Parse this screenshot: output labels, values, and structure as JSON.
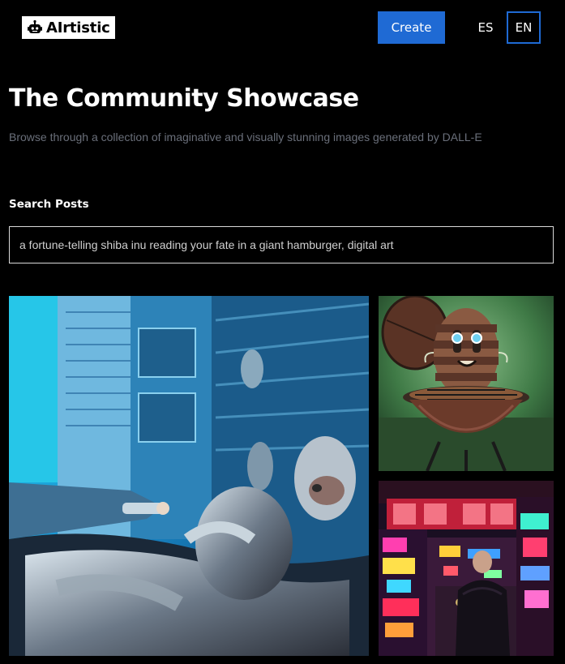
{
  "header": {
    "logo_text": "AIrtistic",
    "create_label": "Create",
    "languages": [
      "ES",
      "EN"
    ],
    "active_language": "EN"
  },
  "intro": {
    "title": "The Community Showcase",
    "subtitle": "Browse through a collection of imaginative and visually stunning images generated by DALL-E"
  },
  "search": {
    "label": "Search Posts",
    "value": "a fortune-telling shiba inu reading your fate in a giant hamburger, digital art"
  },
  "gallery": {
    "images": [
      {
        "icon": "cyber-robot-image"
      },
      {
        "icon": "grill-egg-mascot-image"
      },
      {
        "icon": "neon-street-image"
      }
    ]
  },
  "colors": {
    "background": "#000000",
    "accent": "#1f6ad4",
    "subtitle": "#6a6f7a"
  }
}
